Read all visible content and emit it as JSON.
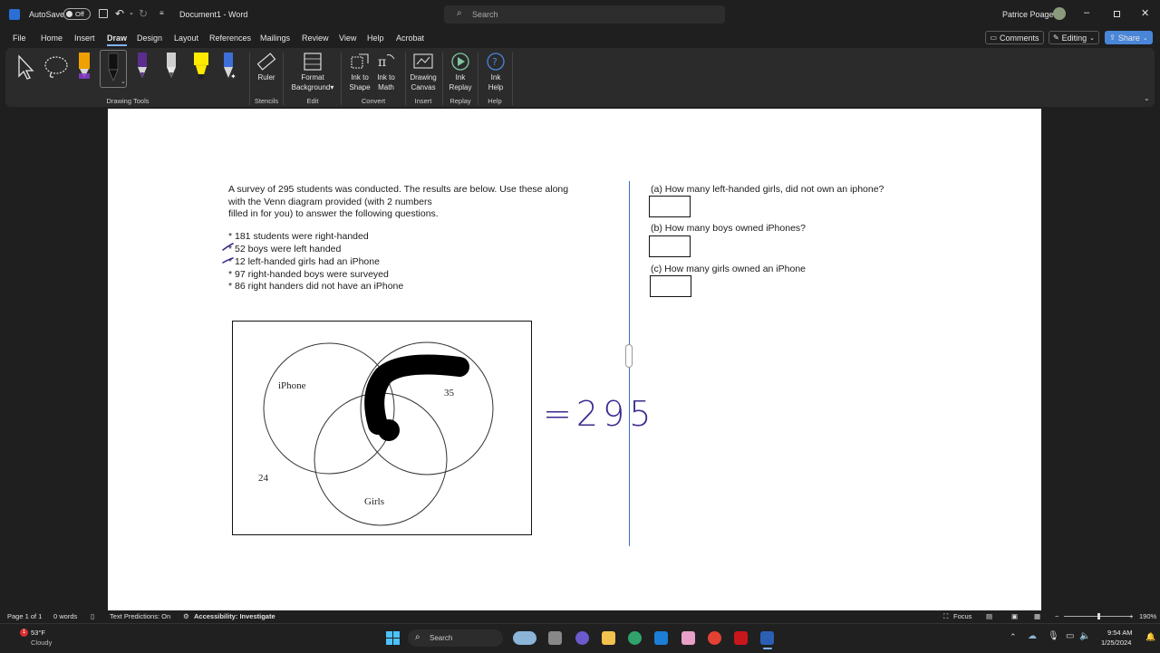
{
  "titlebar": {
    "autosave_label": "AutoSave",
    "autosave_state": "Off",
    "document_title": "Document1 - Word",
    "search_placeholder": "Search",
    "user_name": "Patrice Poage"
  },
  "menu": {
    "tabs": [
      "File",
      "Home",
      "Insert",
      "Draw",
      "Design",
      "Layout",
      "References",
      "Mailings",
      "Review",
      "View",
      "Help",
      "Acrobat"
    ],
    "active_tab": "Draw",
    "comments_label": "Comments",
    "editing_label": "Editing",
    "share_label": "Share"
  },
  "ribbon": {
    "groups": {
      "drawing_tools": "Drawing Tools",
      "stencils": "Stencils",
      "edit": "Edit",
      "convert": "Convert",
      "insert": "Insert",
      "replay": "Replay",
      "help": "Help"
    },
    "buttons": {
      "ruler": "Ruler",
      "format_background_1": "Format",
      "format_background_2": "Background",
      "ink_to_shape_1": "Ink to",
      "ink_to_shape_2": "Shape",
      "ink_to_math_1": "Ink to",
      "ink_to_math_2": "Math",
      "drawing_canvas_1": "Drawing",
      "drawing_canvas_2": "Canvas",
      "ink_replay_1": "Ink",
      "ink_replay_2": "Replay",
      "ink_help_1": "Ink",
      "ink_help_2": "Help"
    },
    "pen_colors": [
      "#f0a000",
      "#111111",
      "#5b2d8c",
      "#b0b0b0",
      "#ffeb00",
      "#3c6fd8"
    ]
  },
  "document": {
    "intro_line1": "A survey of 295 students was conducted. The results are below.  Use these along",
    "intro_line2": "with the Venn diagram provided (with 2 numbers",
    "intro_line3": "filled in for you) to answer the following questions.",
    "facts": [
      "* 181 students were right-handed",
      "* 52 boys were left handed",
      "* 12 left-handed girls had an iPhone",
      "* 97 right-handed boys were surveyed",
      "* 86 right handers did not have an iPhone"
    ],
    "venn": {
      "label_iphone": "iPhone",
      "label_girls": "Girls",
      "value_35": "35",
      "value_24": "24"
    },
    "handwritten_equation": "=295",
    "questions": [
      "(a) How many left-handed girls, did not own an iphone?",
      "(b) How many boys owned iPhones?",
      "(c) How many girls owned an iPhone"
    ],
    "ink_color": "#3b2a8f"
  },
  "statusbar": {
    "page_info": "Page 1 of 1",
    "word_count": "0 words",
    "text_predictions": "Text Predictions: On",
    "accessibility": "Accessibility: Investigate",
    "focus": "Focus",
    "zoom": "190%"
  },
  "taskbar": {
    "weather_temp": "53°F",
    "weather_desc": "Cloudy",
    "weather_badge": "1",
    "search_label": "Search",
    "time": "9:54 AM",
    "date": "1/25/2024"
  }
}
